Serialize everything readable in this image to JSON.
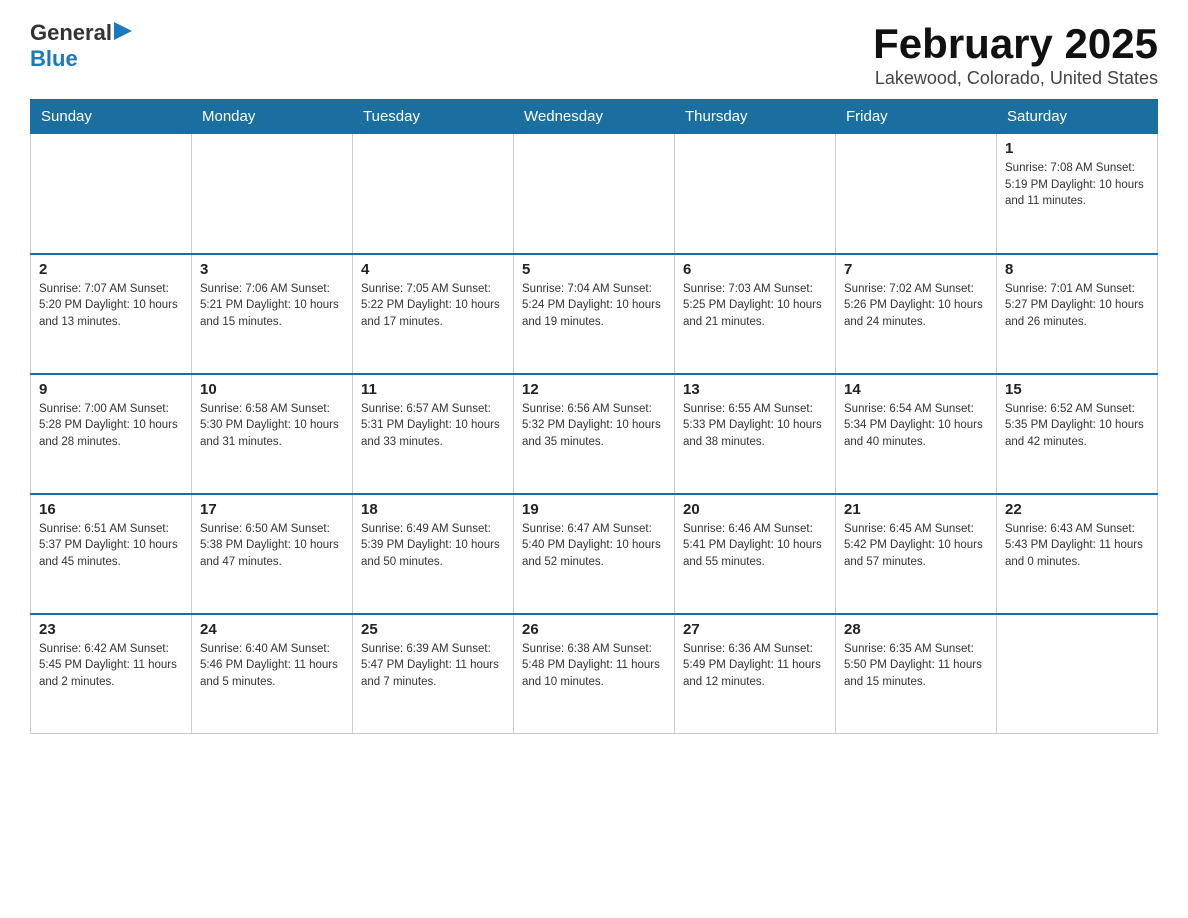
{
  "logo": {
    "text_general": "General",
    "text_blue": "Blue",
    "arrow": "▶"
  },
  "title": "February 2025",
  "subtitle": "Lakewood, Colorado, United States",
  "days_of_week": [
    "Sunday",
    "Monday",
    "Tuesday",
    "Wednesday",
    "Thursday",
    "Friday",
    "Saturday"
  ],
  "weeks": [
    [
      {
        "day": "",
        "info": ""
      },
      {
        "day": "",
        "info": ""
      },
      {
        "day": "",
        "info": ""
      },
      {
        "day": "",
        "info": ""
      },
      {
        "day": "",
        "info": ""
      },
      {
        "day": "",
        "info": ""
      },
      {
        "day": "1",
        "info": "Sunrise: 7:08 AM\nSunset: 5:19 PM\nDaylight: 10 hours and 11 minutes."
      }
    ],
    [
      {
        "day": "2",
        "info": "Sunrise: 7:07 AM\nSunset: 5:20 PM\nDaylight: 10 hours and 13 minutes."
      },
      {
        "day": "3",
        "info": "Sunrise: 7:06 AM\nSunset: 5:21 PM\nDaylight: 10 hours and 15 minutes."
      },
      {
        "day": "4",
        "info": "Sunrise: 7:05 AM\nSunset: 5:22 PM\nDaylight: 10 hours and 17 minutes."
      },
      {
        "day": "5",
        "info": "Sunrise: 7:04 AM\nSunset: 5:24 PM\nDaylight: 10 hours and 19 minutes."
      },
      {
        "day": "6",
        "info": "Sunrise: 7:03 AM\nSunset: 5:25 PM\nDaylight: 10 hours and 21 minutes."
      },
      {
        "day": "7",
        "info": "Sunrise: 7:02 AM\nSunset: 5:26 PM\nDaylight: 10 hours and 24 minutes."
      },
      {
        "day": "8",
        "info": "Sunrise: 7:01 AM\nSunset: 5:27 PM\nDaylight: 10 hours and 26 minutes."
      }
    ],
    [
      {
        "day": "9",
        "info": "Sunrise: 7:00 AM\nSunset: 5:28 PM\nDaylight: 10 hours and 28 minutes."
      },
      {
        "day": "10",
        "info": "Sunrise: 6:58 AM\nSunset: 5:30 PM\nDaylight: 10 hours and 31 minutes."
      },
      {
        "day": "11",
        "info": "Sunrise: 6:57 AM\nSunset: 5:31 PM\nDaylight: 10 hours and 33 minutes."
      },
      {
        "day": "12",
        "info": "Sunrise: 6:56 AM\nSunset: 5:32 PM\nDaylight: 10 hours and 35 minutes."
      },
      {
        "day": "13",
        "info": "Sunrise: 6:55 AM\nSunset: 5:33 PM\nDaylight: 10 hours and 38 minutes."
      },
      {
        "day": "14",
        "info": "Sunrise: 6:54 AM\nSunset: 5:34 PM\nDaylight: 10 hours and 40 minutes."
      },
      {
        "day": "15",
        "info": "Sunrise: 6:52 AM\nSunset: 5:35 PM\nDaylight: 10 hours and 42 minutes."
      }
    ],
    [
      {
        "day": "16",
        "info": "Sunrise: 6:51 AM\nSunset: 5:37 PM\nDaylight: 10 hours and 45 minutes."
      },
      {
        "day": "17",
        "info": "Sunrise: 6:50 AM\nSunset: 5:38 PM\nDaylight: 10 hours and 47 minutes."
      },
      {
        "day": "18",
        "info": "Sunrise: 6:49 AM\nSunset: 5:39 PM\nDaylight: 10 hours and 50 minutes."
      },
      {
        "day": "19",
        "info": "Sunrise: 6:47 AM\nSunset: 5:40 PM\nDaylight: 10 hours and 52 minutes."
      },
      {
        "day": "20",
        "info": "Sunrise: 6:46 AM\nSunset: 5:41 PM\nDaylight: 10 hours and 55 minutes."
      },
      {
        "day": "21",
        "info": "Sunrise: 6:45 AM\nSunset: 5:42 PM\nDaylight: 10 hours and 57 minutes."
      },
      {
        "day": "22",
        "info": "Sunrise: 6:43 AM\nSunset: 5:43 PM\nDaylight: 11 hours and 0 minutes."
      }
    ],
    [
      {
        "day": "23",
        "info": "Sunrise: 6:42 AM\nSunset: 5:45 PM\nDaylight: 11 hours and 2 minutes."
      },
      {
        "day": "24",
        "info": "Sunrise: 6:40 AM\nSunset: 5:46 PM\nDaylight: 11 hours and 5 minutes."
      },
      {
        "day": "25",
        "info": "Sunrise: 6:39 AM\nSunset: 5:47 PM\nDaylight: 11 hours and 7 minutes."
      },
      {
        "day": "26",
        "info": "Sunrise: 6:38 AM\nSunset: 5:48 PM\nDaylight: 11 hours and 10 minutes."
      },
      {
        "day": "27",
        "info": "Sunrise: 6:36 AM\nSunset: 5:49 PM\nDaylight: 11 hours and 12 minutes."
      },
      {
        "day": "28",
        "info": "Sunrise: 6:35 AM\nSunset: 5:50 PM\nDaylight: 11 hours and 15 minutes."
      },
      {
        "day": "",
        "info": ""
      }
    ]
  ]
}
